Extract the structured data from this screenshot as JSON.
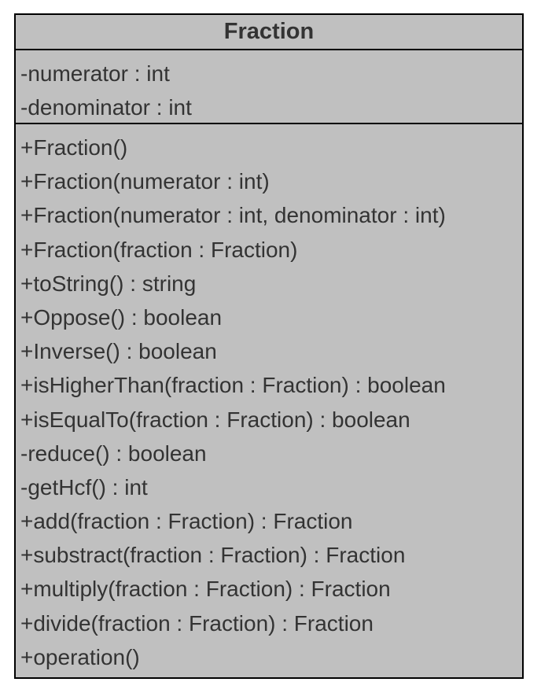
{
  "class": {
    "name": "Fraction",
    "attributes": [
      "-numerator : int",
      "-denominator : int"
    ],
    "operations": [
      "+Fraction()",
      "+Fraction(numerator : int)",
      "+Fraction(numerator : int, denominator : int)",
      "+Fraction(fraction : Fraction)",
      "+toString() : string",
      "+Oppose() : boolean",
      "+Inverse() : boolean",
      "+isHigherThan(fraction : Fraction) : boolean",
      "+isEqualTo(fraction : Fraction) : boolean",
      "-reduce() : boolean",
      "-getHcf() : int",
      "+add(fraction : Fraction) : Fraction",
      "+substract(fraction : Fraction) : Fraction",
      "+multiply(fraction : Fraction) : Fraction",
      "+divide(fraction : Fraction) : Fraction",
      "+operation()"
    ]
  },
  "colors": {
    "box_fill": "#c0c0c0",
    "border": "#000000",
    "text": "#333333"
  }
}
